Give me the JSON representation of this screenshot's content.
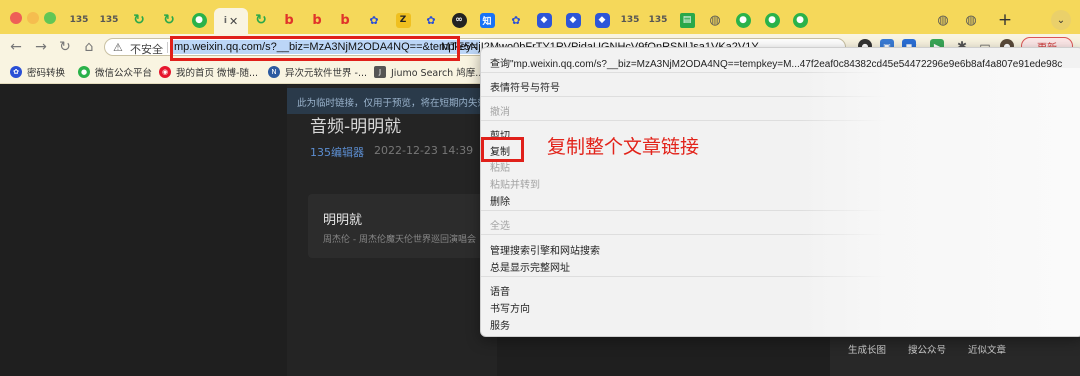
{
  "browser": {
    "tabs": [
      {
        "icon": "135-icon",
        "label": "135"
      },
      {
        "icon": "135-icon",
        "label": "135"
      },
      {
        "icon": "green-refresh-icon",
        "label": ""
      },
      {
        "icon": "green-refresh-icon",
        "label": ""
      },
      {
        "icon": "wechat-icon",
        "label": ""
      },
      {
        "icon": "active-tab-icon",
        "label": "i"
      },
      {
        "icon": "green-refresh-icon",
        "label": ""
      },
      {
        "icon": "red-b-icon",
        "label": "b"
      },
      {
        "icon": "red-b-icon",
        "label": "b"
      },
      {
        "icon": "red-b-icon",
        "label": "b"
      },
      {
        "icon": "paw-icon",
        "label": ""
      },
      {
        "icon": "yellow-z-icon",
        "label": "Z"
      },
      {
        "icon": "paw-icon",
        "label": ""
      },
      {
        "icon": "infinity-icon",
        "label": "∞"
      },
      {
        "icon": "zhihu-icon",
        "label": "知"
      },
      {
        "icon": "paw-icon",
        "label": ""
      },
      {
        "icon": "blue-cube-icon",
        "label": ""
      },
      {
        "icon": "blue-cube-icon",
        "label": ""
      },
      {
        "icon": "blue-cube-icon",
        "label": ""
      },
      {
        "icon": "135-icon",
        "label": "135"
      },
      {
        "icon": "135-icon",
        "label": "135"
      },
      {
        "icon": "green-doc-icon",
        "label": ""
      },
      {
        "icon": "globe-icon",
        "label": ""
      },
      {
        "icon": "wechat-icon",
        "label": ""
      },
      {
        "icon": "wechat-icon",
        "label": ""
      },
      {
        "icon": "wechat-icon",
        "label": ""
      },
      {
        "icon": "globe-icon",
        "label": ""
      },
      {
        "icon": "globe-icon",
        "label": ""
      }
    ],
    "new_tab_label": "+",
    "tab_menu_label": "⌄",
    "security_label": "不安全",
    "url_selected": "mp.weixin.qq.com/s?__biz=MzA3NjM2ODA4NQ==&tempkey=",
    "url_rest": "MTE5NjI2Mwo0bFrTY1RVPjdaUGNHcV9fQnRSNlJsa1VKa2V1Y",
    "update_label": "更新"
  },
  "bookmarks": [
    {
      "icon": "paw-icon",
      "label": "密码转换"
    },
    {
      "icon": "wechat-icon",
      "label": "微信公众平台"
    },
    {
      "icon": "weibo-icon",
      "label": "我的首页 微博-随..."
    },
    {
      "icon": "n-icon",
      "label": "异次元软件世界 -..."
    },
    {
      "icon": "j-icon",
      "label": "Jiumo Search 鸠摩..."
    }
  ],
  "page": {
    "temp_notice": "此为临时链接，仅用于预览，将在短期内失效",
    "article_title": "音频-明明就",
    "source": "135编辑器",
    "date": "2022-12-23 14:39",
    "music": {
      "title": "明明就",
      "subtitle": "周杰伦 - 周杰伦魔天伦世界巡回演唱会"
    },
    "bottom_links": [
      "生成长图",
      "搜公众号",
      "近似文章"
    ]
  },
  "context_menu": {
    "lookup": "查询\"mp.weixin.qq.com/s?__biz=MzA3NjM2ODA4NQ==tempkey=M...47f2eaf0c84382cd45e54472296e9e6b8af4a807e91ede98c",
    "emoji": "表情符号与符号",
    "undo": "撤消",
    "cut": "剪切",
    "copy": "复制",
    "paste": "粘贴",
    "paste_go": "粘贴并转到",
    "delete": "删除",
    "select_all": "全选",
    "manage_search": "管理搜索引擎和网站搜索",
    "show_full_url": "总是显示完整网址",
    "speech": "语音",
    "writing_direction": "书写方向",
    "services": "服务"
  },
  "annotation": "复制整个文章链接",
  "colors": {
    "tabbar": "#f5d85a",
    "toolbar": "#f9f4e1",
    "highlight": "#e0201a",
    "url_selection": "#bcd6f7",
    "page_bg": "#1f1f1f"
  }
}
